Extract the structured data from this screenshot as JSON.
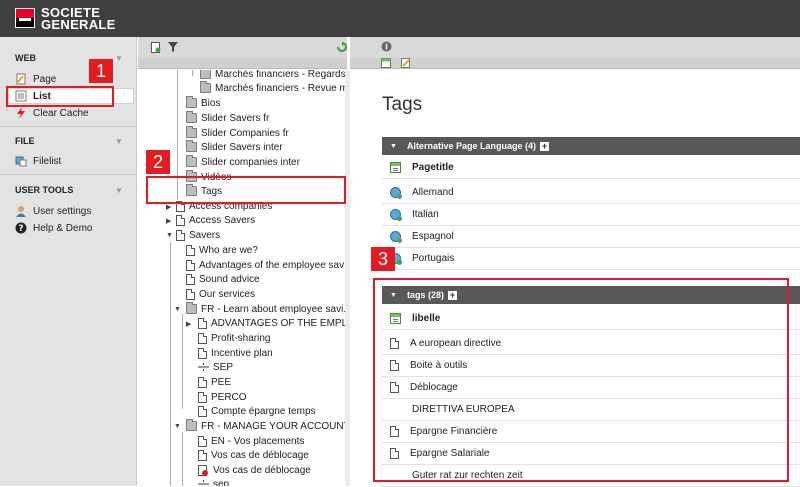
{
  "brand": {
    "line1": "SOCIETE",
    "line2": "GENERALE"
  },
  "modules": {
    "web": {
      "title": "WEB",
      "items": [
        "Page",
        "List",
        "Clear Cache"
      ]
    },
    "file": {
      "title": "FILE",
      "items": [
        "Filelist"
      ]
    },
    "user_tools": {
      "title": "USER TOOLS",
      "items": [
        "User settings",
        "Help & Demo"
      ]
    }
  },
  "tree": [
    "Marchés financiers - Regards s",
    "Marchés financiers - Revue m",
    "Bios",
    "Slider Savers fr",
    "Slider Companies fr",
    "Slider Savers inter",
    "Slider companies inter",
    "Vidéos",
    "Tags",
    "Access companies",
    "Access Savers",
    "Savers",
    "Who are we?",
    "Advantages of the employee sav",
    "Sound advice",
    "Our services",
    "FR - Learn about employee savi..",
    "ADVANTAGES OF THE EMPLOY",
    "Profit-sharing",
    "Incentive plan",
    "SEP",
    "PEE",
    "PERCO",
    "Compte épargne temps",
    "FR - MANAGE YOUR ACCOUNT",
    "EN - Vos placements",
    "Vos cas de déblocage",
    "Vos cas de déblocage",
    "sep"
  ],
  "content": {
    "title": "Tags",
    "section1": {
      "label": "Alternative Page Language (4)",
      "header": "Pagetitle",
      "rows": [
        "Allemand",
        "Italian",
        "Espagnol",
        "Portugais"
      ]
    },
    "section2": {
      "label": "tags (28)",
      "header": "libelle",
      "rows": [
        "A european directive",
        "Boite à outils",
        "Déblocage",
        "DIRETTIVA EUROPEA",
        "Epargne Financière",
        "Epargne Salariale",
        "Guter rat zur rechten zeit"
      ]
    }
  },
  "callouts": [
    "1",
    "2",
    "3"
  ],
  "colors": {
    "accent": "#e31b23",
    "brand_red": "#e60028",
    "topbar": "#3f3f3f"
  }
}
